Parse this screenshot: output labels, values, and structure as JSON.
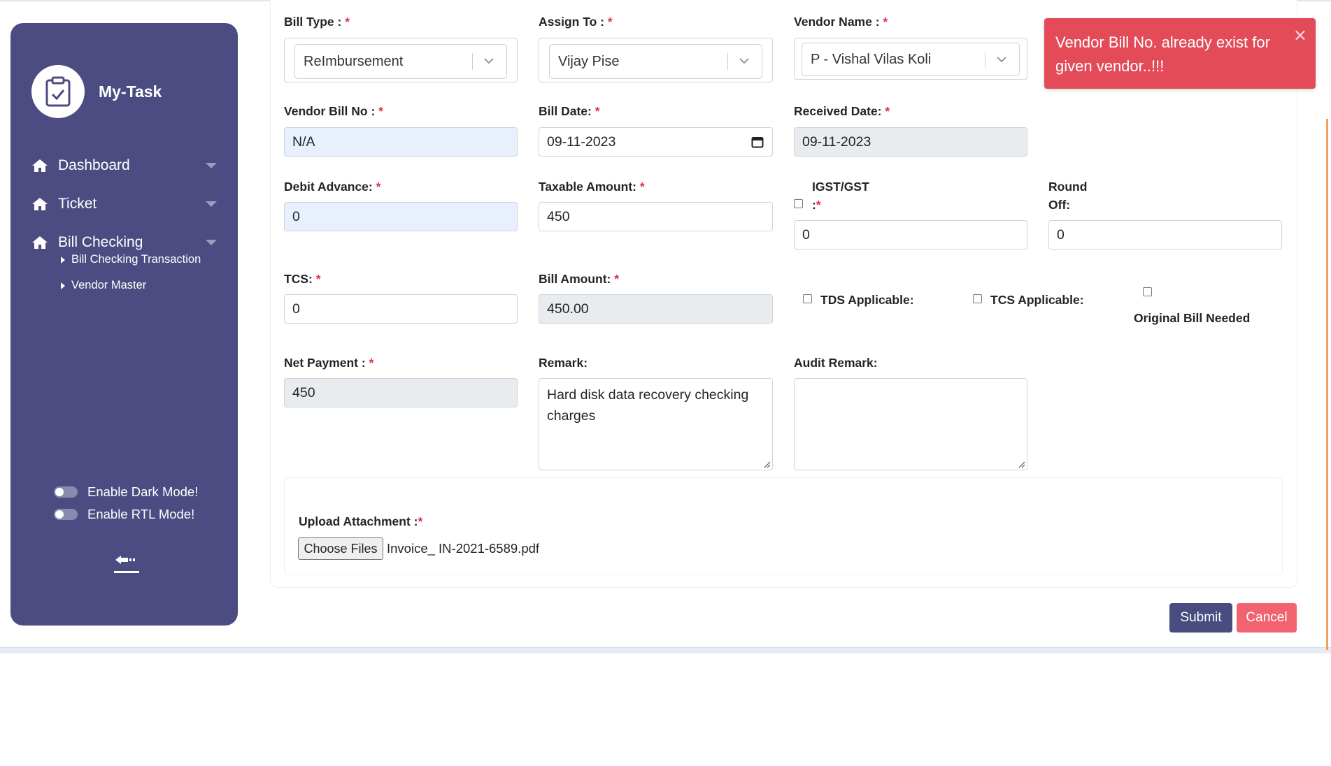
{
  "sidebar": {
    "brand": "My-Task",
    "nav": [
      {
        "label": "Dashboard",
        "icon": "home-icon"
      },
      {
        "label": "Ticket",
        "icon": "home-icon"
      },
      {
        "label": "Bill Checking",
        "icon": "home-icon"
      }
    ],
    "sub_items": [
      "Bill Checking Transaction",
      "Vendor Master"
    ],
    "toggles": [
      "Enable Dark Mode!",
      "Enable RTL Mode!"
    ]
  },
  "form": {
    "bill_type": {
      "label": "Bill Type :",
      "required": "*",
      "value": "ReImbursement"
    },
    "assign_to": {
      "label": "Assign To :",
      "required": "*",
      "value": "Vijay Pise"
    },
    "vendor_name": {
      "label": "Vendor Name :",
      "required": "*",
      "value": "P - Vishal Vilas Koli"
    },
    "vendor_bill_no": {
      "label": "Vendor Bill No :",
      "required": "*",
      "value": "N/A"
    },
    "bill_date": {
      "label": "Bill Date:",
      "required": "*",
      "value": "09-11-2023"
    },
    "received_date": {
      "label": "Received Date:",
      "required": "*",
      "value": "09-11-2023"
    },
    "debit_advance": {
      "label": "Debit Advance:",
      "required": "*",
      "value": "0"
    },
    "taxable_amount": {
      "label": "Taxable Amount:",
      "required": "*",
      "value": "450"
    },
    "igst_gst": {
      "label_line1": "IGST/GST",
      "label_line2": ":",
      "required": "*",
      "value": "0"
    },
    "round_off": {
      "label_line1": "Round",
      "label_line2": "Off:",
      "value": "0"
    },
    "tcs": {
      "label": "TCS:",
      "required": "*",
      "value": "0"
    },
    "bill_amount": {
      "label": "Bill Amount:",
      "required": "*",
      "value": "450.00"
    },
    "tds_applicable": {
      "label": "TDS Applicable:"
    },
    "tcs_applicable": {
      "label": "TCS Applicable:"
    },
    "original_bill": {
      "label": "Original Bill Needed"
    },
    "net_payment": {
      "label": "Net Payment :",
      "required": "*",
      "value": "450"
    },
    "remark": {
      "label": "Remark:",
      "value": "Hard disk data recovery checking charges"
    },
    "audit_remark": {
      "label": "Audit Remark:",
      "value": ""
    },
    "upload": {
      "label": "Upload Attachment :",
      "required": "*",
      "button": "Choose Files",
      "file_name": "Invoice_ IN-2021-6589.pdf"
    }
  },
  "actions": {
    "submit": "Submit",
    "cancel": "Cancel"
  },
  "toast": {
    "message": "Vendor Bill No. already exist for given vendor..!!!",
    "close": "×"
  },
  "colors": {
    "sidebar": "#4c4c82",
    "submit": "#484c7f",
    "cancel": "#f1646f",
    "toast": "#e34b59",
    "required": "#dc3545"
  }
}
